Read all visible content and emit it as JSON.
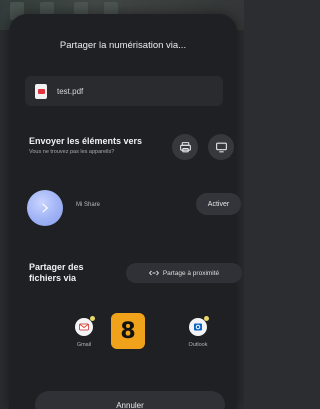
{
  "sheet": {
    "title": "Partager la numérisation via...",
    "file": {
      "name": "test.pdf",
      "icon": "pdf-file-icon"
    },
    "send": {
      "title": "Envoyer les éléments vers",
      "subtitle": "Vous ne trouvez pas les appareils?",
      "buttons": [
        {
          "icon": "print-icon"
        },
        {
          "icon": "screen-cast-icon"
        }
      ]
    },
    "mishare": {
      "name": "Mi Share",
      "icon": "mi-share-icon",
      "action_label": "Activer"
    },
    "share_files": {
      "title": "Partager des fichiers via",
      "nearby_label": "Partage à proximité",
      "nearby_icon": "nearby-share-icon"
    },
    "apps": [
      {
        "label": "Gmail",
        "icon": "gmail-icon"
      },
      {
        "label": "Outlook",
        "icon": "outlook-icon"
      }
    ],
    "badge": "8",
    "cancel_label": "Annuler"
  },
  "colors": {
    "sheet_bg": "#1f2023",
    "button_bg": "#303136",
    "badge": "#f0a21a",
    "pdf_red": "#e2343c",
    "mishare_blue": "#9fb2f5"
  }
}
